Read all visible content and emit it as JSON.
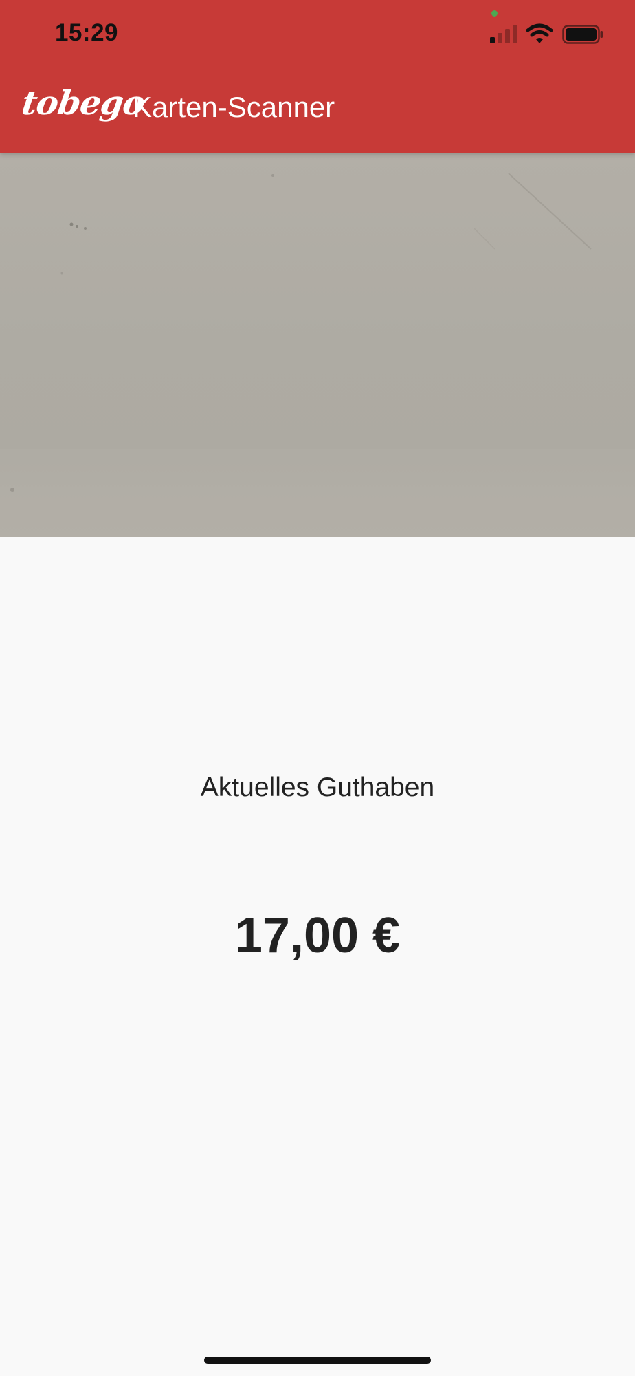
{
  "status_bar": {
    "time": "15:29",
    "icons": [
      "signal-icon",
      "wifi-icon",
      "battery-icon"
    ]
  },
  "app_bar": {
    "logo": "tobego",
    "title": "Karten-Scanner",
    "background_color": "#c73a37"
  },
  "camera": {
    "icon": "camera-preview"
  },
  "balance": {
    "label": "Aktuelles Guthaben",
    "value": "17,00 €"
  }
}
